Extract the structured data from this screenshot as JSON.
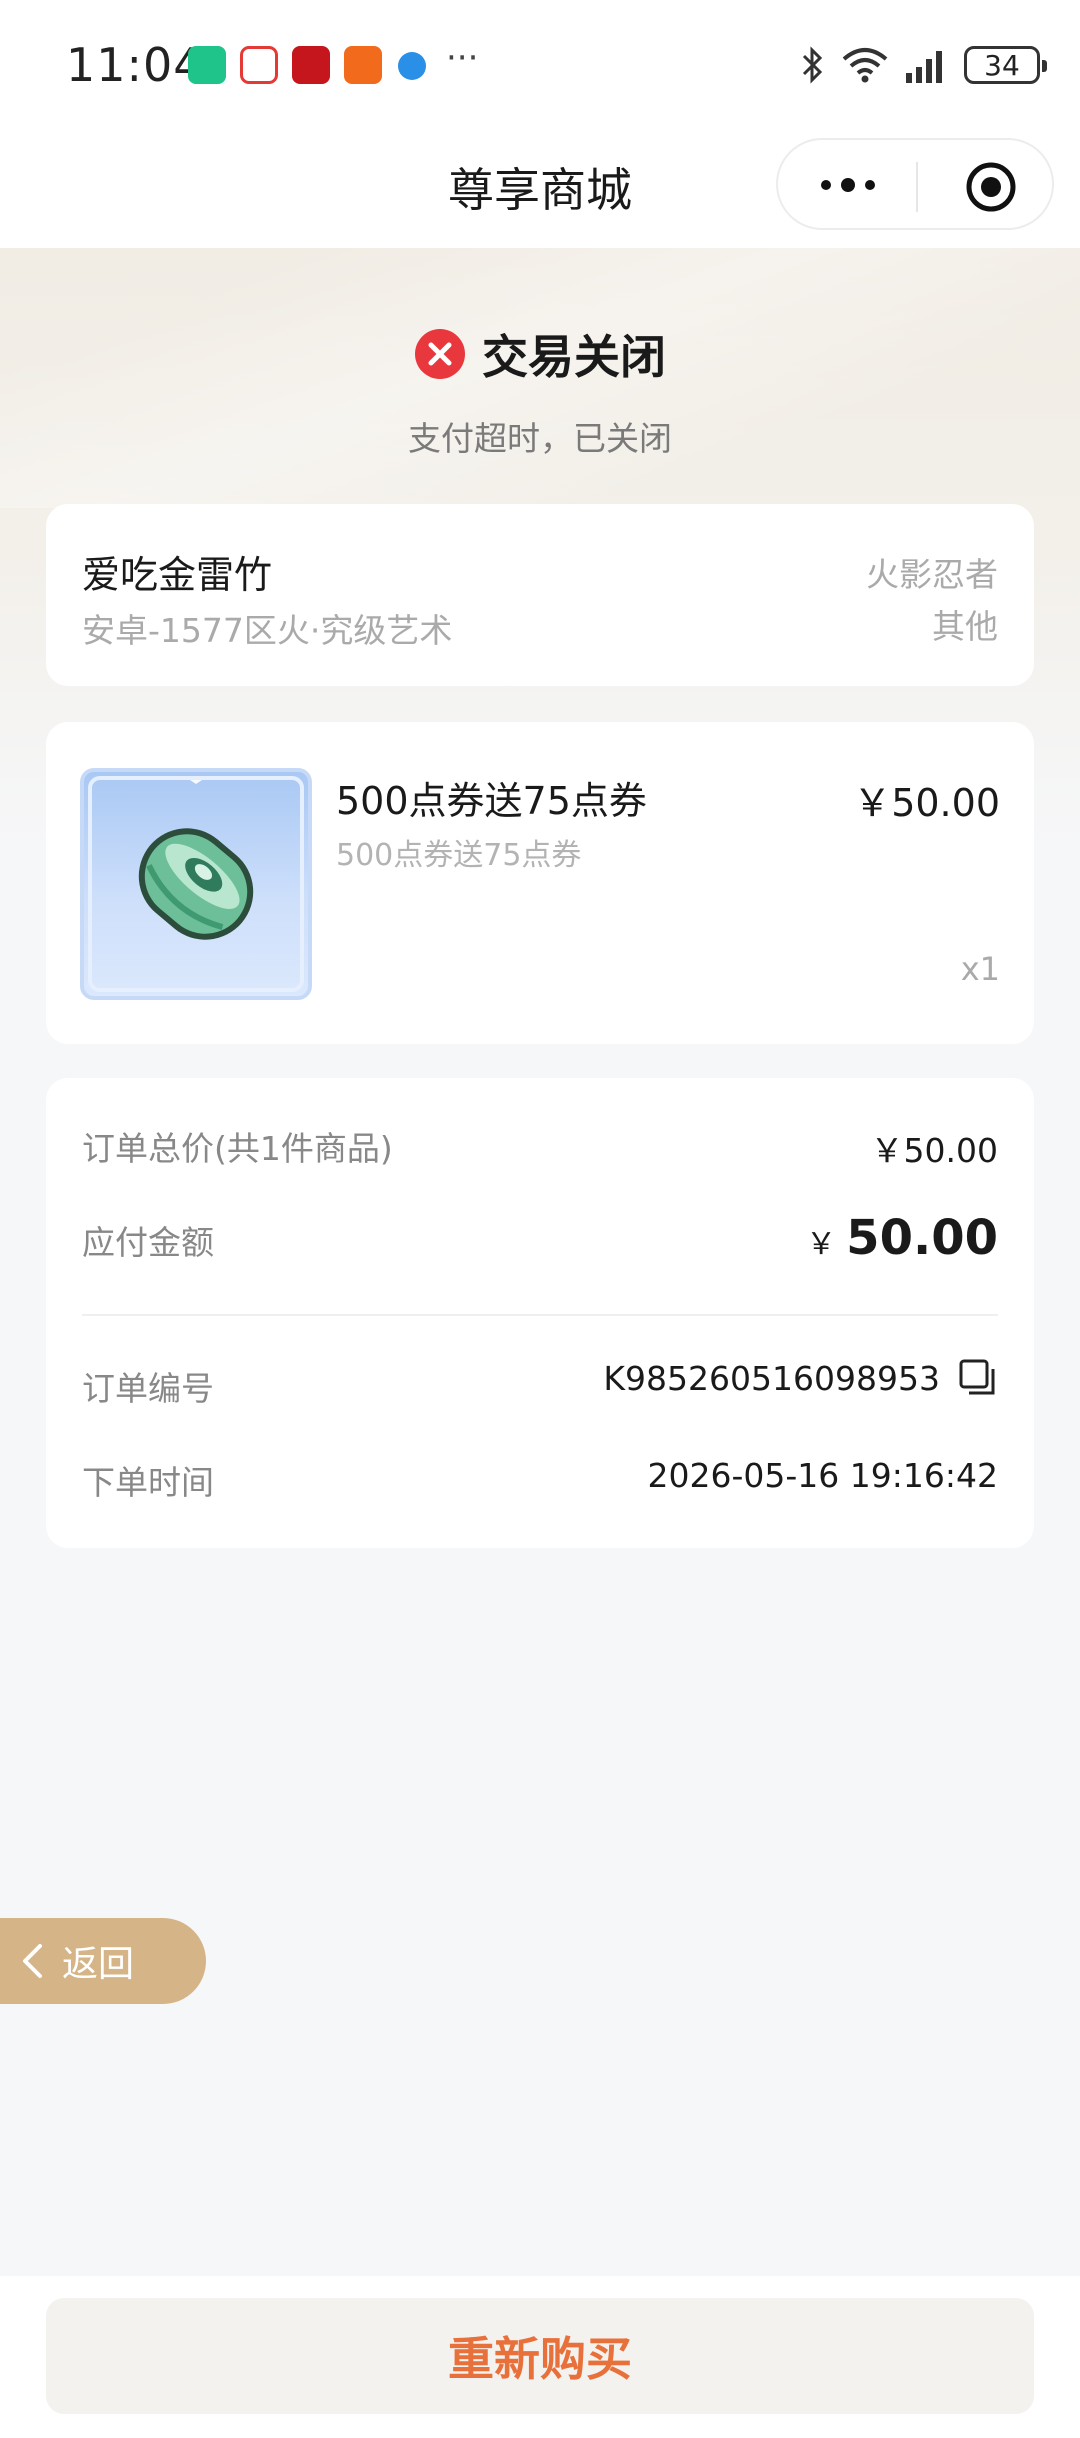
{
  "status_bar": {
    "time": "11:04",
    "more": "···",
    "battery": "34"
  },
  "nav": {
    "title": "尊享商城"
  },
  "order_status": {
    "title": "交易关闭",
    "subtitle": "支付超时，已关闭"
  },
  "account": {
    "name": "爱吃金雷竹",
    "server": "安卓-1577区火·究级艺术",
    "game": "火影忍者",
    "category": "其他"
  },
  "product": {
    "name": "500点券送75点券",
    "subtitle": "500点券送75点券",
    "price": "￥50.00",
    "quantity": "x1"
  },
  "summary": {
    "total_label": "订单总价(共1件商品)",
    "total_value": "￥50.00",
    "payable_label": "应付金额",
    "payable_currency": "￥",
    "payable_value": "50.00",
    "order_no_label": "订单编号",
    "order_no": "K985260516098953",
    "order_time_label": "下单时间",
    "order_time": "2026-05-16 19:16:42"
  },
  "back_label": "返回",
  "rebuy_label": "重新购买",
  "colors": {
    "accent": "#e8703a",
    "back_button": "#d5b487",
    "error_red": "#e8383d"
  }
}
